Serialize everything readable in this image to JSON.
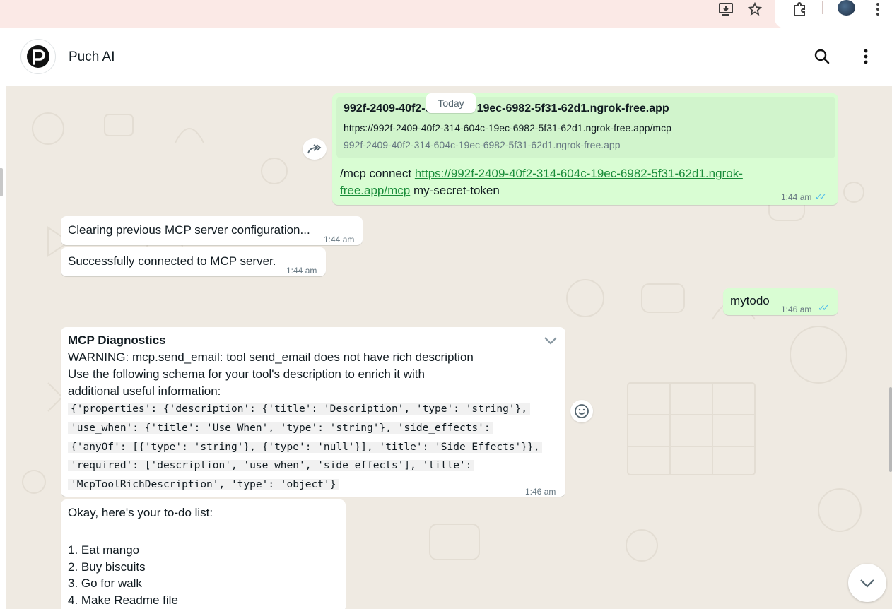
{
  "header": {
    "title": "Puch AI"
  },
  "date_divider": "Today",
  "messages": {
    "link_preview": {
      "title": "992f-2409-40f2-314-604c-19ec-6982-5f31-62d1.ngrok-free.app",
      "url": "https://992f-2409-40f2-314-604c-19ec-6982-5f31-62d1.ngrok-free.app/mcp",
      "domain": "992f-2409-40f2-314-604c-19ec-6982-5f31-62d1.ngrok-free.app"
    },
    "connect": {
      "prefix": "/mcp connect ",
      "link_line1": "https://992f-2409-40f2-314-604c-19ec-6982-5f31-62d1.ngrok-",
      "link_line2": "free.app/mcp",
      "suffix": " my-secret-token",
      "time": "1:44 am"
    },
    "clearing": {
      "text": "Clearing previous MCP server configuration...",
      "time": "1:44 am"
    },
    "connected": {
      "text": "Successfully connected to MCP server.",
      "time": "1:44 am"
    },
    "mytodo": {
      "text": "mytodo",
      "time": "1:46 am"
    },
    "diagnostics": {
      "title": "MCP Diagnostics",
      "line1": "WARNING: mcp.send_email: tool send_email does not have rich description",
      "line2": "Use the following schema for your tool's description to enrich it with",
      "line3": "additional useful information:",
      "code1": "{'properties': {'description': {'title': 'Description', 'type': 'string'},",
      "code2": "'use_when': {'title': 'Use When', 'type': 'string'}, 'side_effects':",
      "code3": "{'anyOf': [{'type': 'string'}, {'type': 'null'}], 'title': 'Side Effects'}},",
      "code4": "'required': ['description', 'use_when', 'side_effects'], 'title':",
      "code5": "'McpToolRichDescription', 'type': 'object'}",
      "time": "1:46 am"
    },
    "todo": {
      "intro": "Okay, here's your to-do list:",
      "items": [
        "1. Eat mango",
        "2. Buy biscuits",
        "3. Go for walk",
        "4. Make Readme file"
      ]
    }
  },
  "colors": {
    "incoming": "#ffffff",
    "outgoing": "#d9fdd3",
    "background": "#efeae2",
    "ticks": "#53bdeb"
  },
  "icons": [
    "install-icon",
    "star-icon",
    "extensions-icon",
    "profile-avatar",
    "browser-menu-icon",
    "puch-logo",
    "search-icon",
    "menu-icon",
    "forward-icon",
    "emoji-icon",
    "chevron-down-icon",
    "scroll-down-icon"
  ]
}
